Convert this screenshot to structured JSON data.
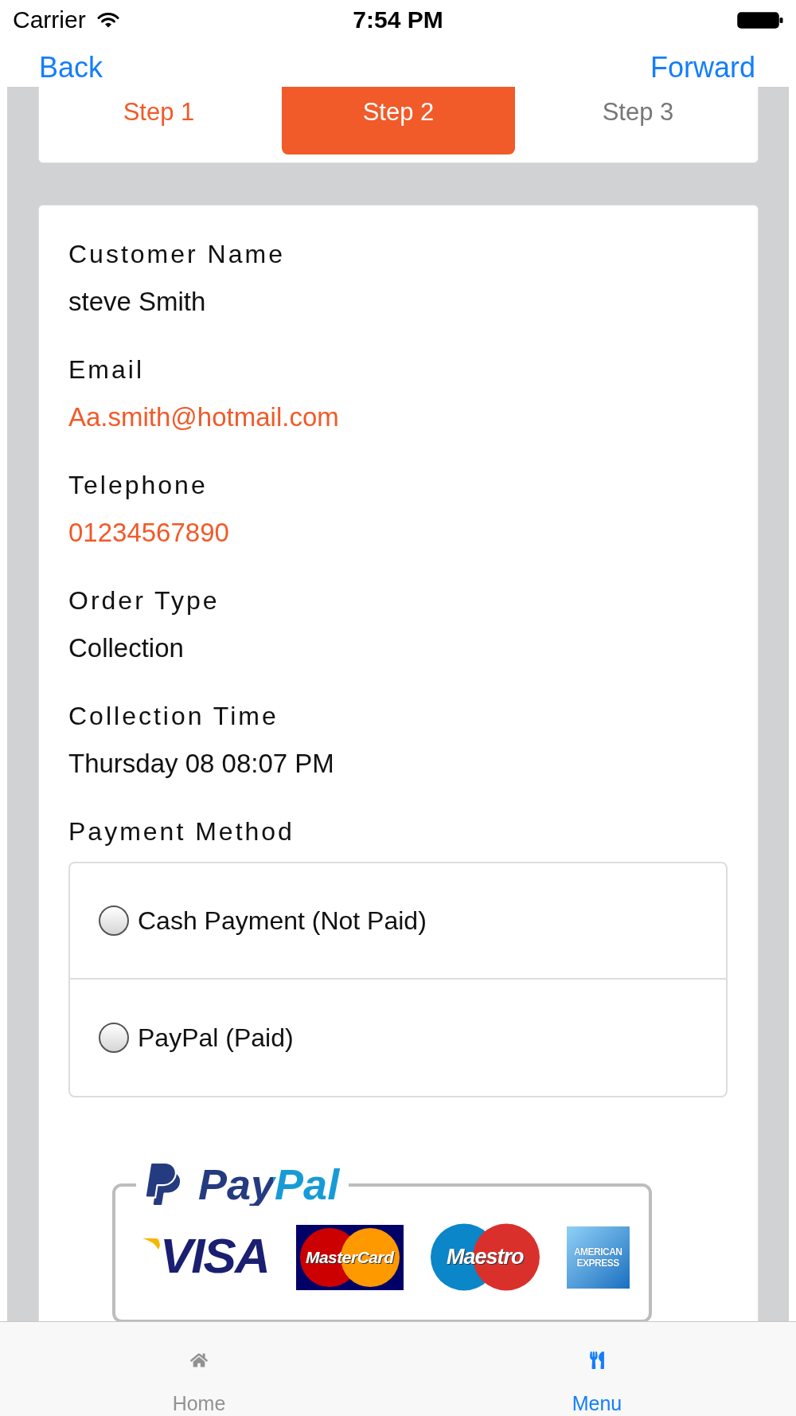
{
  "status_bar": {
    "carrier": "Carrier",
    "time": "7:54 PM"
  },
  "nav_bar": {
    "back": "Back",
    "forward": "Forward"
  },
  "steps": [
    {
      "label": "Step 1",
      "selected": false,
      "completed": true
    },
    {
      "label": "Step 2",
      "selected": true,
      "completed": false
    },
    {
      "label": "Step 3",
      "selected": false,
      "completed": false
    }
  ],
  "details": [
    {
      "label": "Customer Name",
      "value": "steve Smith",
      "kind": "text"
    },
    {
      "label": "Email",
      "value": "Aa.smith@hotmail.com",
      "kind": "link"
    },
    {
      "label": "Telephone",
      "value": "01234567890",
      "kind": "link"
    },
    {
      "label": "Order Type",
      "value": "Collection",
      "kind": "text"
    },
    {
      "label": "Collection Time",
      "value": "Thursday 08 08:07 PM",
      "kind": "text"
    }
  ],
  "payment_method": {
    "label": "Payment Method",
    "options": [
      {
        "label": "Cash Payment (Not Paid)",
        "selected": false
      },
      {
        "label": "PayPal (Paid)",
        "selected": false
      }
    ]
  },
  "payment_logos": {
    "wordmark": "PayPal",
    "cards": [
      {
        "kind": "visa",
        "text": [
          "VISA"
        ]
      },
      {
        "kind": "mastercard",
        "text": [
          "MasterCard"
        ]
      },
      {
        "kind": "maestro",
        "text": [
          "Maestro"
        ]
      },
      {
        "kind": "amex",
        "text": [
          "AMERICAN",
          "EXPRESS"
        ]
      }
    ]
  },
  "tab_bar": [
    {
      "label": "Home",
      "selected": false
    },
    {
      "label": "Menu",
      "selected": true
    }
  ]
}
